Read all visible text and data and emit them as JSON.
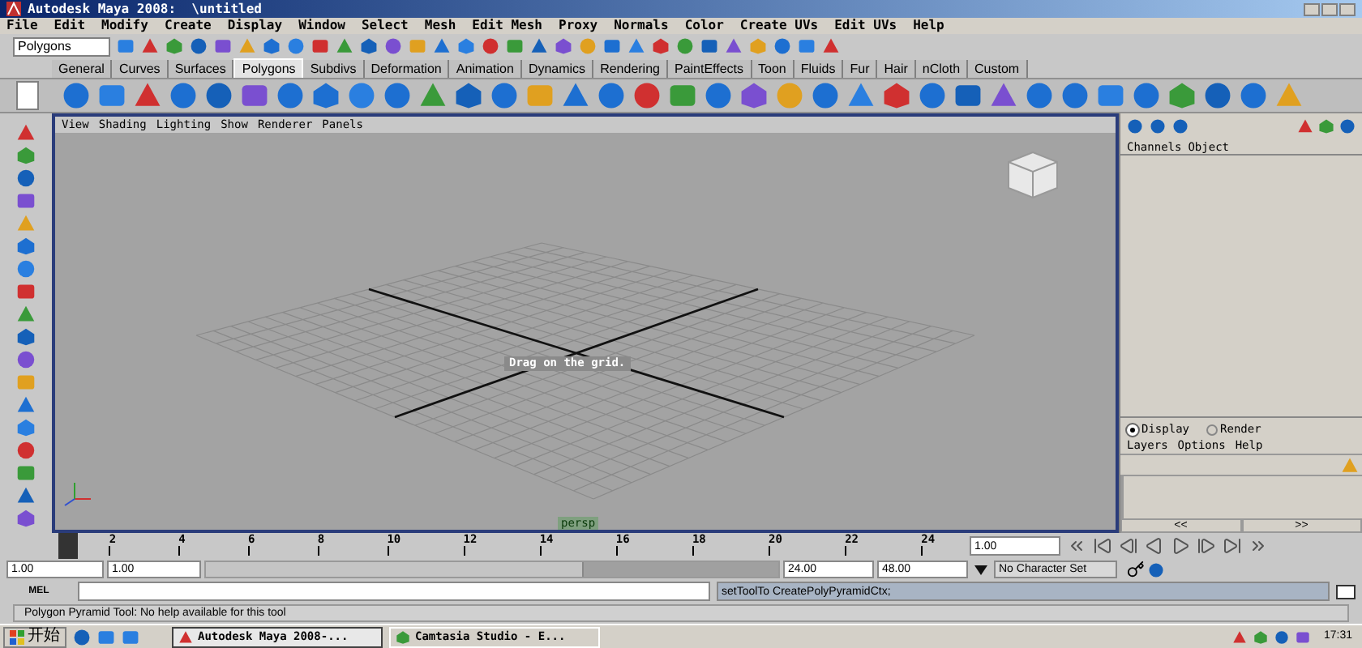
{
  "window": {
    "title": "Autodesk Maya 2008:  \\untitled"
  },
  "menu": [
    "File",
    "Edit",
    "Modify",
    "Create",
    "Display",
    "Window",
    "Select",
    "Mesh",
    "Edit Mesh",
    "Proxy",
    "Normals",
    "Color",
    "Create UVs",
    "Edit UVs",
    "Help"
  ],
  "status_line": {
    "mode": "Polygons"
  },
  "shelf_tabs": [
    {
      "label": "General",
      "selected": false
    },
    {
      "label": "Curves",
      "selected": false
    },
    {
      "label": "Surfaces",
      "selected": false
    },
    {
      "label": "Polygons",
      "selected": true
    },
    {
      "label": "Subdivs",
      "selected": false
    },
    {
      "label": "Deformation",
      "selected": false
    },
    {
      "label": "Animation",
      "selected": false
    },
    {
      "label": "Dynamics",
      "selected": false
    },
    {
      "label": "Rendering",
      "selected": false
    },
    {
      "label": "PaintEffects",
      "selected": false
    },
    {
      "label": "Toon",
      "selected": false
    },
    {
      "label": "Fluids",
      "selected": false
    },
    {
      "label": "Fur",
      "selected": false
    },
    {
      "label": "Hair",
      "selected": false
    },
    {
      "label": "nCloth",
      "selected": false
    },
    {
      "label": "Custom",
      "selected": false
    }
  ],
  "viewport": {
    "menu": [
      "View",
      "Shading",
      "Lighting",
      "Show",
      "Renderer",
      "Panels"
    ],
    "tooltip": "Drag on the grid.",
    "camera": "persp"
  },
  "channel_box": {
    "menu": [
      "Channels",
      "Object"
    ]
  },
  "layer_editor": {
    "modes": [
      {
        "label": "Display",
        "selected": true
      },
      {
        "label": "Render",
        "selected": false
      }
    ],
    "menu": [
      "Layers",
      "Options",
      "Help"
    ],
    "buttons": [
      "<<",
      ">>"
    ]
  },
  "time_slider": {
    "ticks": [
      "2",
      "4",
      "6",
      "8",
      "10",
      "12",
      "14",
      "16",
      "18",
      "20",
      "22",
      "24"
    ],
    "current_frame": "1.00",
    "level": 0
  },
  "range": {
    "start": "1.00",
    "playback_start": "1.00",
    "playback_end": "24.00",
    "end": "48.00",
    "level": 0.66,
    "character_set": "No Character Set"
  },
  "command_line": {
    "label": "MEL",
    "result": "setToolTo CreatePolyPyramidCtx;"
  },
  "help_line": "Polygon Pyramid Tool: No help available for this tool",
  "taskbar": {
    "start": "开始",
    "tasks": [
      {
        "label": "Autodesk Maya 2008-...",
        "selected": true
      },
      {
        "label": "Camtasia Studio - E...",
        "selected": false
      }
    ],
    "clock": "17:31"
  }
}
